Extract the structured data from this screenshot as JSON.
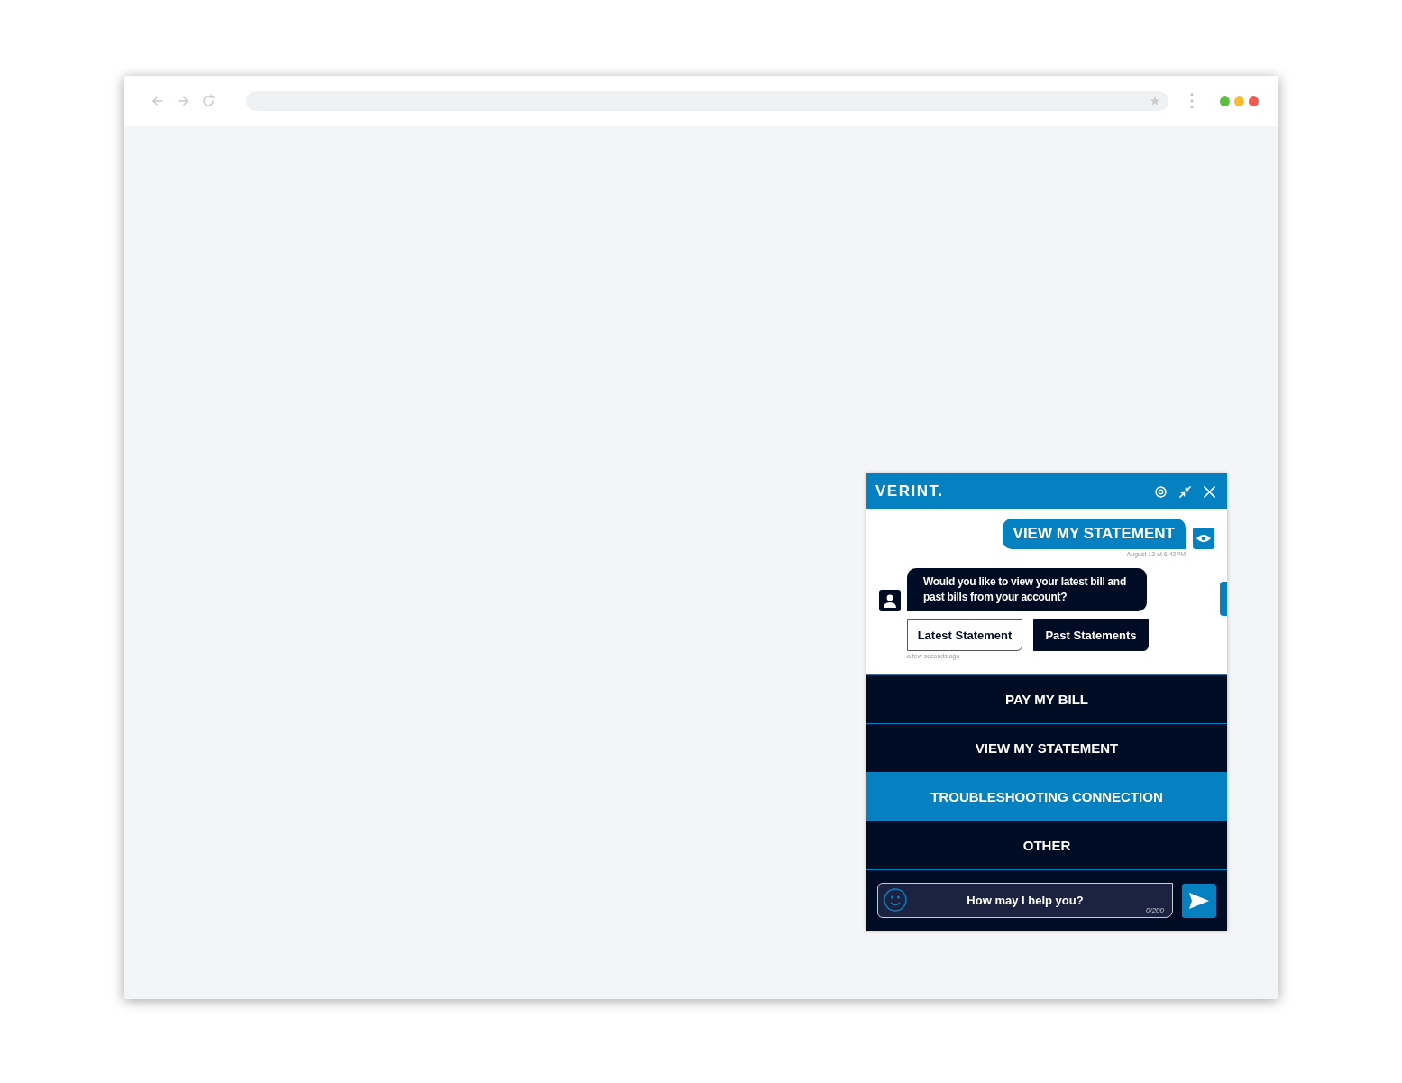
{
  "chat_widget": {
    "brand": "VERINT.",
    "messages": [
      {
        "kind": "user",
        "text": "VIEW MY STATEMENT",
        "time": "August 13 at 6:42PM"
      },
      {
        "kind": "bot",
        "text": "Would you like to view your latest bill and past bills from your account?",
        "time": "a few seconds ago",
        "quick_replies": [
          {
            "label": "Latest Statement",
            "selected": false
          },
          {
            "label": "Past Statements",
            "selected": true
          }
        ]
      }
    ],
    "menu": [
      {
        "label": "PAY MY BILL",
        "selected": false
      },
      {
        "label": "VIEW MY STATEMENT",
        "selected": false
      },
      {
        "label": "TROUBLESHOOTING CONNECTION",
        "selected": true
      },
      {
        "label": "OTHER",
        "selected": false
      }
    ],
    "input": {
      "placeholder": "How may I help you?",
      "counter": "0/200"
    }
  }
}
